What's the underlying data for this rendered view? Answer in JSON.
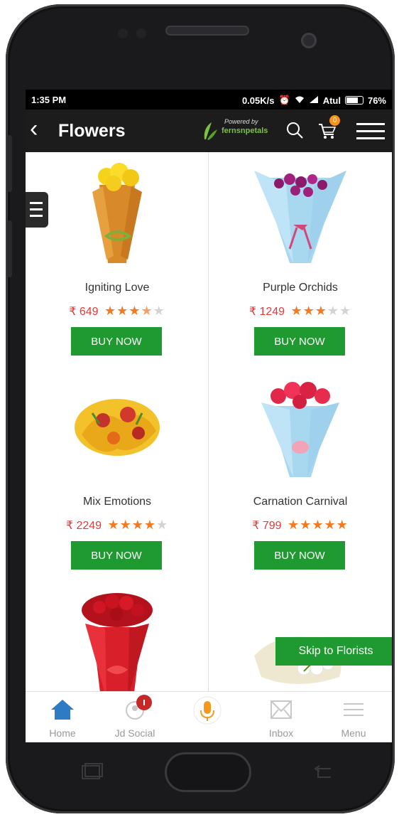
{
  "status_bar": {
    "time": "1:35 PM",
    "network_speed": "0.05K/s",
    "carrier": "Atul",
    "battery": "76%"
  },
  "app_bar": {
    "title": "Flowers",
    "powered_by_label": "Powered by",
    "brand": "fernsnpetals",
    "cart_count": "0"
  },
  "products": [
    {
      "name": "Igniting Love",
      "price": "₹ 649",
      "rating": 3.5,
      "buy_label": "BUY NOW",
      "image_icon": "bouquet-yellow-roses-image"
    },
    {
      "name": "Purple Orchids",
      "price": "₹ 1249",
      "rating": 3,
      "buy_label": "BUY NOW",
      "image_icon": "bouquet-purple-orchids-image"
    },
    {
      "name": "Mix Emotions",
      "price": "₹ 2249",
      "rating": 4,
      "buy_label": "BUY NOW",
      "image_icon": "bouquet-mixed-lilies-image"
    },
    {
      "name": "Carnation Carnival",
      "price": "₹ 799",
      "rating": 5,
      "buy_label": "BUY NOW",
      "image_icon": "bouquet-carnations-image"
    },
    {
      "name": "",
      "price": "",
      "rating": 0,
      "buy_label": "",
      "image_icon": "bouquet-red-roses-image"
    },
    {
      "name": "",
      "price": "",
      "rating": 0,
      "buy_label": "",
      "image_icon": "bouquet-white-flowers-image"
    }
  ],
  "skip_button": {
    "label": "Skip to Florists"
  },
  "bottom_nav": [
    {
      "label": "Home",
      "icon": "home-icon"
    },
    {
      "label": "Jd Social",
      "icon": "social-icon"
    },
    {
      "label": "",
      "icon": "mic-icon"
    },
    {
      "label": "Inbox",
      "icon": "inbox-icon"
    },
    {
      "label": "Menu",
      "icon": "menu-icon"
    }
  ],
  "colors": {
    "accent_green": "#1f9a31",
    "price_red": "#e53935",
    "star_orange": "#f47920",
    "app_bar": "#1c1c1c"
  }
}
